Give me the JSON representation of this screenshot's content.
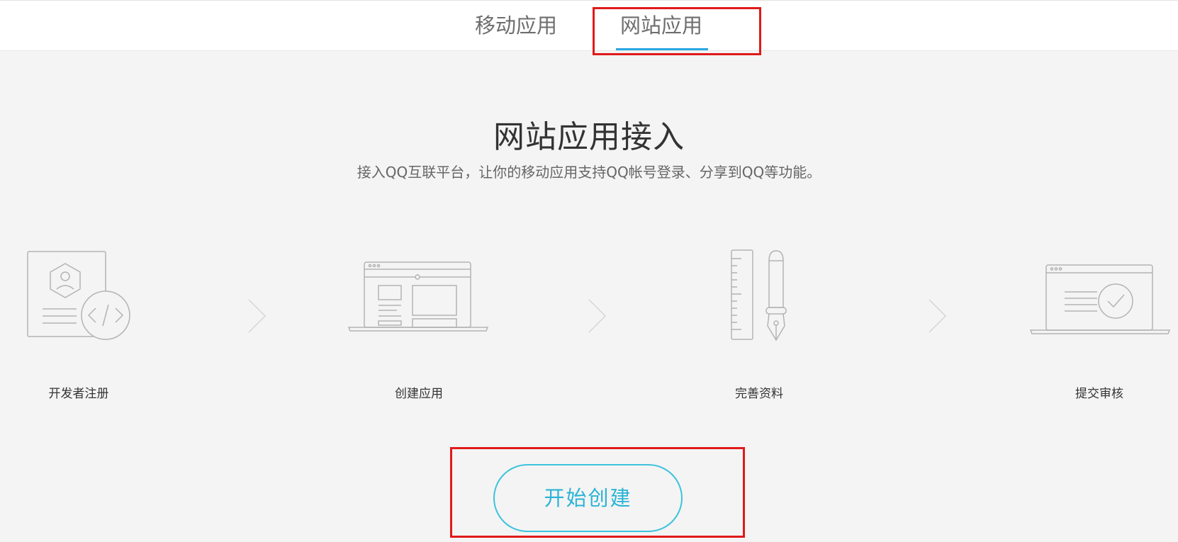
{
  "tabs": {
    "mobile_label": "移动应用",
    "web_label": "网站应用",
    "active": "web"
  },
  "hero": {
    "title": "网站应用接入",
    "subtitle": "接入QQ互联平台，让你的移动应用支持QQ帐号登录、分享到QQ等功能。"
  },
  "steps": [
    {
      "label": "开发者注册",
      "icon": "developer-register-icon"
    },
    {
      "label": "创建应用",
      "icon": "create-app-icon"
    },
    {
      "label": "完善资料",
      "icon": "complete-info-icon"
    },
    {
      "label": "提交审核",
      "icon": "submit-review-icon"
    }
  ],
  "start_button": {
    "label": "开始创建"
  },
  "colors": {
    "accent": "#2aa6e3",
    "button": "#2bb4d6",
    "highlight": "#e01a1a",
    "background": "#f4f4f4",
    "icon_stroke": "#b3b3b3"
  }
}
